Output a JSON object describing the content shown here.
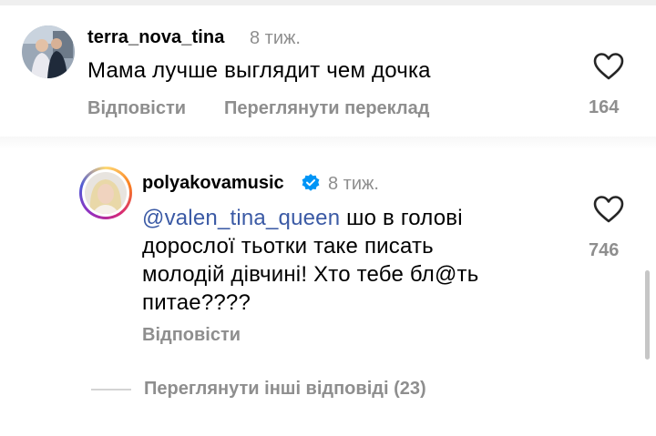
{
  "comments": [
    {
      "username": "terra_nova_tina",
      "time": "8 тиж.",
      "text": "Мама лучше выглядит чем дочка",
      "reply_label": "Відповісти",
      "translate_label": "Переглянути переклад",
      "likes": "164"
    }
  ],
  "reply": {
    "username": "polyakovamusic",
    "verified": true,
    "time": "8 тиж.",
    "mention": "@valen_tina_queen",
    "text": " шо в голові дорослої тьотки таке писать молодій дівчині! Хто тебе бл@ть питае????",
    "reply_label": "Відповісти",
    "likes": "746"
  },
  "view_more_replies": "Переглянути інші відповіді (23)",
  "colors": {
    "muted": "#8e8e8e",
    "mention": "#3b5aa5",
    "verified": "#0095f6"
  },
  "icons": [
    "heart-icon",
    "verified-badge-icon"
  ]
}
